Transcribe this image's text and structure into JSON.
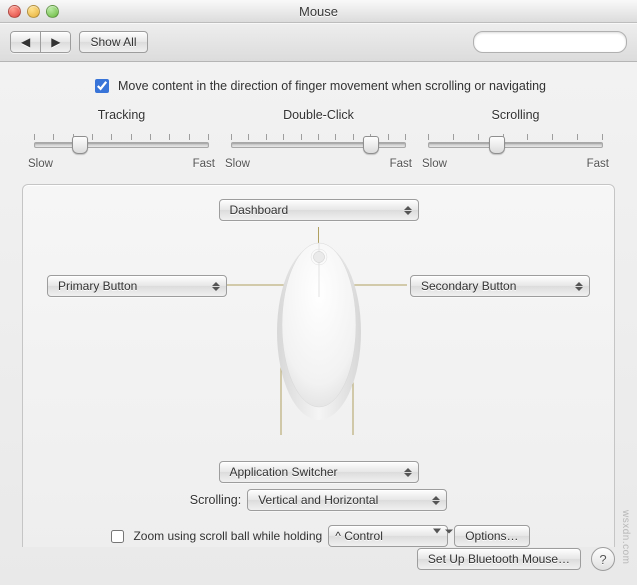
{
  "window": {
    "title": "Mouse"
  },
  "toolbar": {
    "back_label": "◀",
    "forward_label": "▶",
    "show_all_label": "Show All",
    "search_placeholder": ""
  },
  "checkbox": {
    "move_content_label": "Move content in the direction of finger movement when scrolling or navigating",
    "move_content_checked": true
  },
  "sliders": {
    "slow_label": "Slow",
    "fast_label": "Fast",
    "tracking": {
      "title": "Tracking",
      "value_pct": 28,
      "ticks": 10
    },
    "double_click": {
      "title": "Double-Click",
      "value_pct": 78,
      "ticks": 11
    },
    "scrolling": {
      "title": "Scrolling",
      "value_pct": 40,
      "ticks": 8
    }
  },
  "mouse_assignments": {
    "top_button": "Dashboard",
    "left_button": "Primary Button",
    "right_button": "Secondary Button",
    "side_buttons": "Application Switcher"
  },
  "scrolling_behavior": {
    "label": "Scrolling:",
    "value": "Vertical and Horizontal"
  },
  "zoom": {
    "checked": false,
    "label": "Zoom using scroll ball while holding",
    "modifier": "Control",
    "modifier_glyph": "^",
    "options_button": "Options…"
  },
  "footer": {
    "bluetooth_button": "Set Up Bluetooth Mouse…",
    "help_glyph": "?"
  },
  "watermark": "wsxdn.com"
}
